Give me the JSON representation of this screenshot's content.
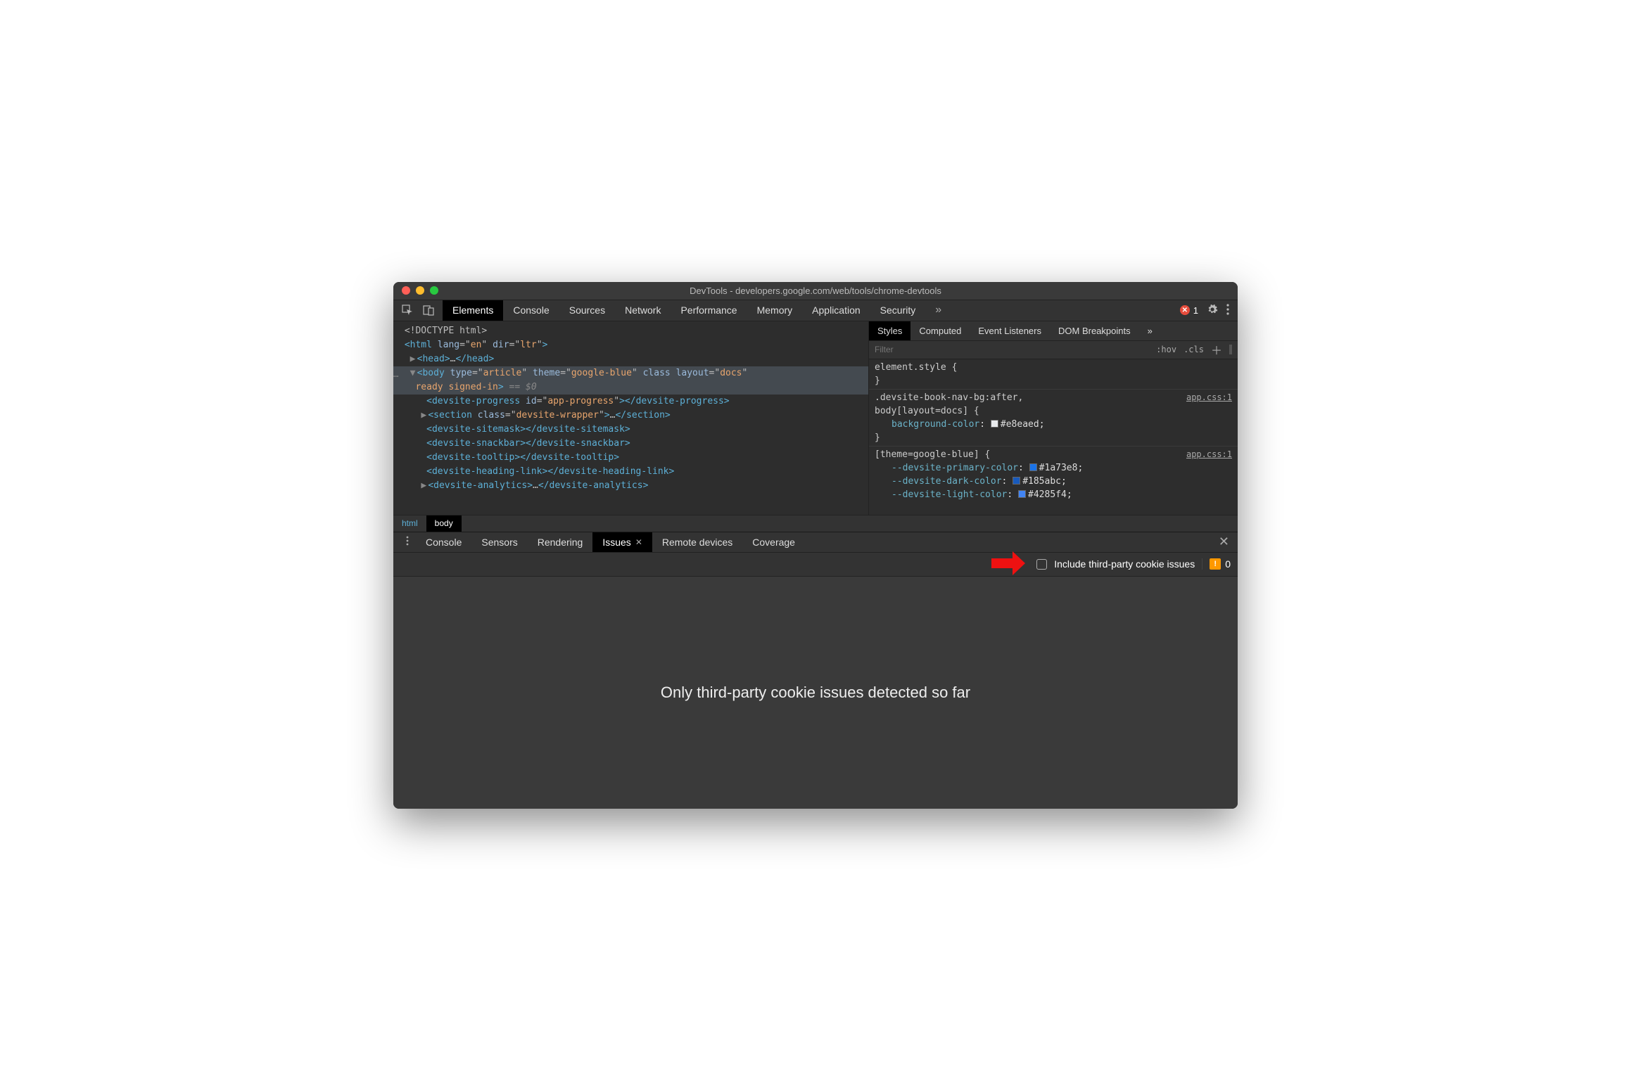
{
  "window": {
    "title": "DevTools - developers.google.com/web/tools/chrome-devtools"
  },
  "main_tabs": {
    "items": [
      "Elements",
      "Console",
      "Sources",
      "Network",
      "Performance",
      "Memory",
      "Application",
      "Security"
    ],
    "active": "Elements",
    "overflow": "»",
    "error_count": "1"
  },
  "dom": {
    "l0": "<!DOCTYPE html>",
    "l1_open": "<html ",
    "l1_attr1_n": "lang",
    "l1_attr1_v": "en",
    "l1_attr2_n": "dir",
    "l1_attr2_v": "ltr",
    "l1_close": ">",
    "l2": "<head>…</head>",
    "l3_open": "<body ",
    "l3_a1_n": "type",
    "l3_a1_v": "article",
    "l3_a2_n": "theme",
    "l3_a2_v": "google-blue",
    "l3_a3_n": "class",
    "l3_a4_n": "layout",
    "l3_a4_v": "docs",
    "l3_line2": "ready signed-in",
    "l3_eq": " == $0",
    "l4": "<devsite-progress id=\"app-progress\"></devsite-progress>",
    "l4_id_n": "id",
    "l4_id_v": "app-progress",
    "l5": "<section class=\"devsite-wrapper\">…</section>",
    "l5_cls_n": "class",
    "l5_cls_v": "devsite-wrapper",
    "l6": "<devsite-sitemask></devsite-sitemask>",
    "l7": "<devsite-snackbar></devsite-snackbar>",
    "l8": "<devsite-tooltip></devsite-tooltip>",
    "l9": "<devsite-heading-link></devsite-heading-link>",
    "l10": "<devsite-analytics>…</devsite-analytics>"
  },
  "breadcrumb": {
    "a": "html",
    "b": "body"
  },
  "styles": {
    "tabs": [
      "Styles",
      "Computed",
      "Event Listeners",
      "DOM Breakpoints"
    ],
    "active": "Styles",
    "overflow": "»",
    "filter_placeholder": "Filter",
    "hov": ":hov",
    "cls": ".cls",
    "r0_sel": "element.style {",
    "r0_close": "}",
    "r1_sel": ".devsite-book-nav-bg:after,\nbody[layout=docs] {",
    "r1_link": "app.css:1",
    "r1_p1_n": "background-color",
    "r1_p1_v": "#e8eaed",
    "r1_p1_col": "#e8eaed",
    "r1_close": "}",
    "r2_sel": "[theme=google-blue] {",
    "r2_link": "app.css:1",
    "r2_p1_n": "--devsite-primary-color",
    "r2_p1_v": "#1a73e8",
    "r2_p1_col": "#1a73e8",
    "r2_p2_n": "--devsite-dark-color",
    "r2_p2_v": "#185abc",
    "r2_p2_col": "#185abc",
    "r2_p3_n": "--devsite-light-color",
    "r2_p3_v": "#4285f4",
    "r2_p3_col": "#4285f4"
  },
  "drawer": {
    "tabs": [
      "Console",
      "Sensors",
      "Rendering",
      "Issues",
      "Remote devices",
      "Coverage"
    ],
    "active": "Issues"
  },
  "issues": {
    "checkbox_label": "Include third-party cookie issues",
    "flag_count": "0",
    "message": "Only third-party cookie issues detected so far"
  }
}
